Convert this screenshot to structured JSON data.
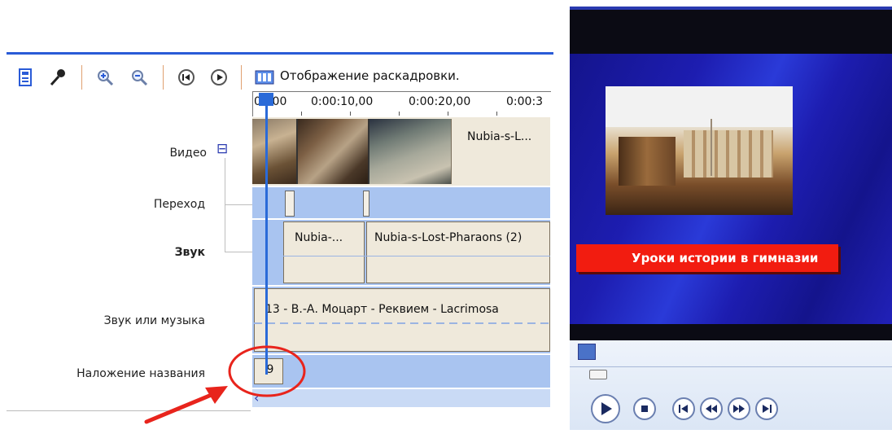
{
  "timeline": {
    "storyboard_button_label": "Отображение раскадровки.",
    "ruler_labels": [
      "00:00",
      "0:00:10,00",
      "0:00:20,00",
      "0:00:3"
    ],
    "tracks": {
      "video": "Видео",
      "transition": "Переход",
      "audio": "Звук",
      "music": "Звук или музыка",
      "title_overlay": "Наложение названия"
    },
    "expand_toggle": "⊟",
    "video_clip_label": "Nubia-s-L...",
    "audio_clips": [
      "Nubia-...",
      "Nubia-s-Lost-Pharaons (2)"
    ],
    "music_clip_label": "13 - В.-А. Моцарт - Реквием - Lacrimosa",
    "title_clip_label": "9"
  },
  "player": {
    "overlay_text": "Уроки истории в гимназии"
  },
  "colors": {
    "accent_blue": "#2a6ad8",
    "lane_blue": "#a9c4f0",
    "highlight_red": "#e8241c",
    "player_bg": "#1b1b9a",
    "title_bar_red": "#f21c10"
  }
}
